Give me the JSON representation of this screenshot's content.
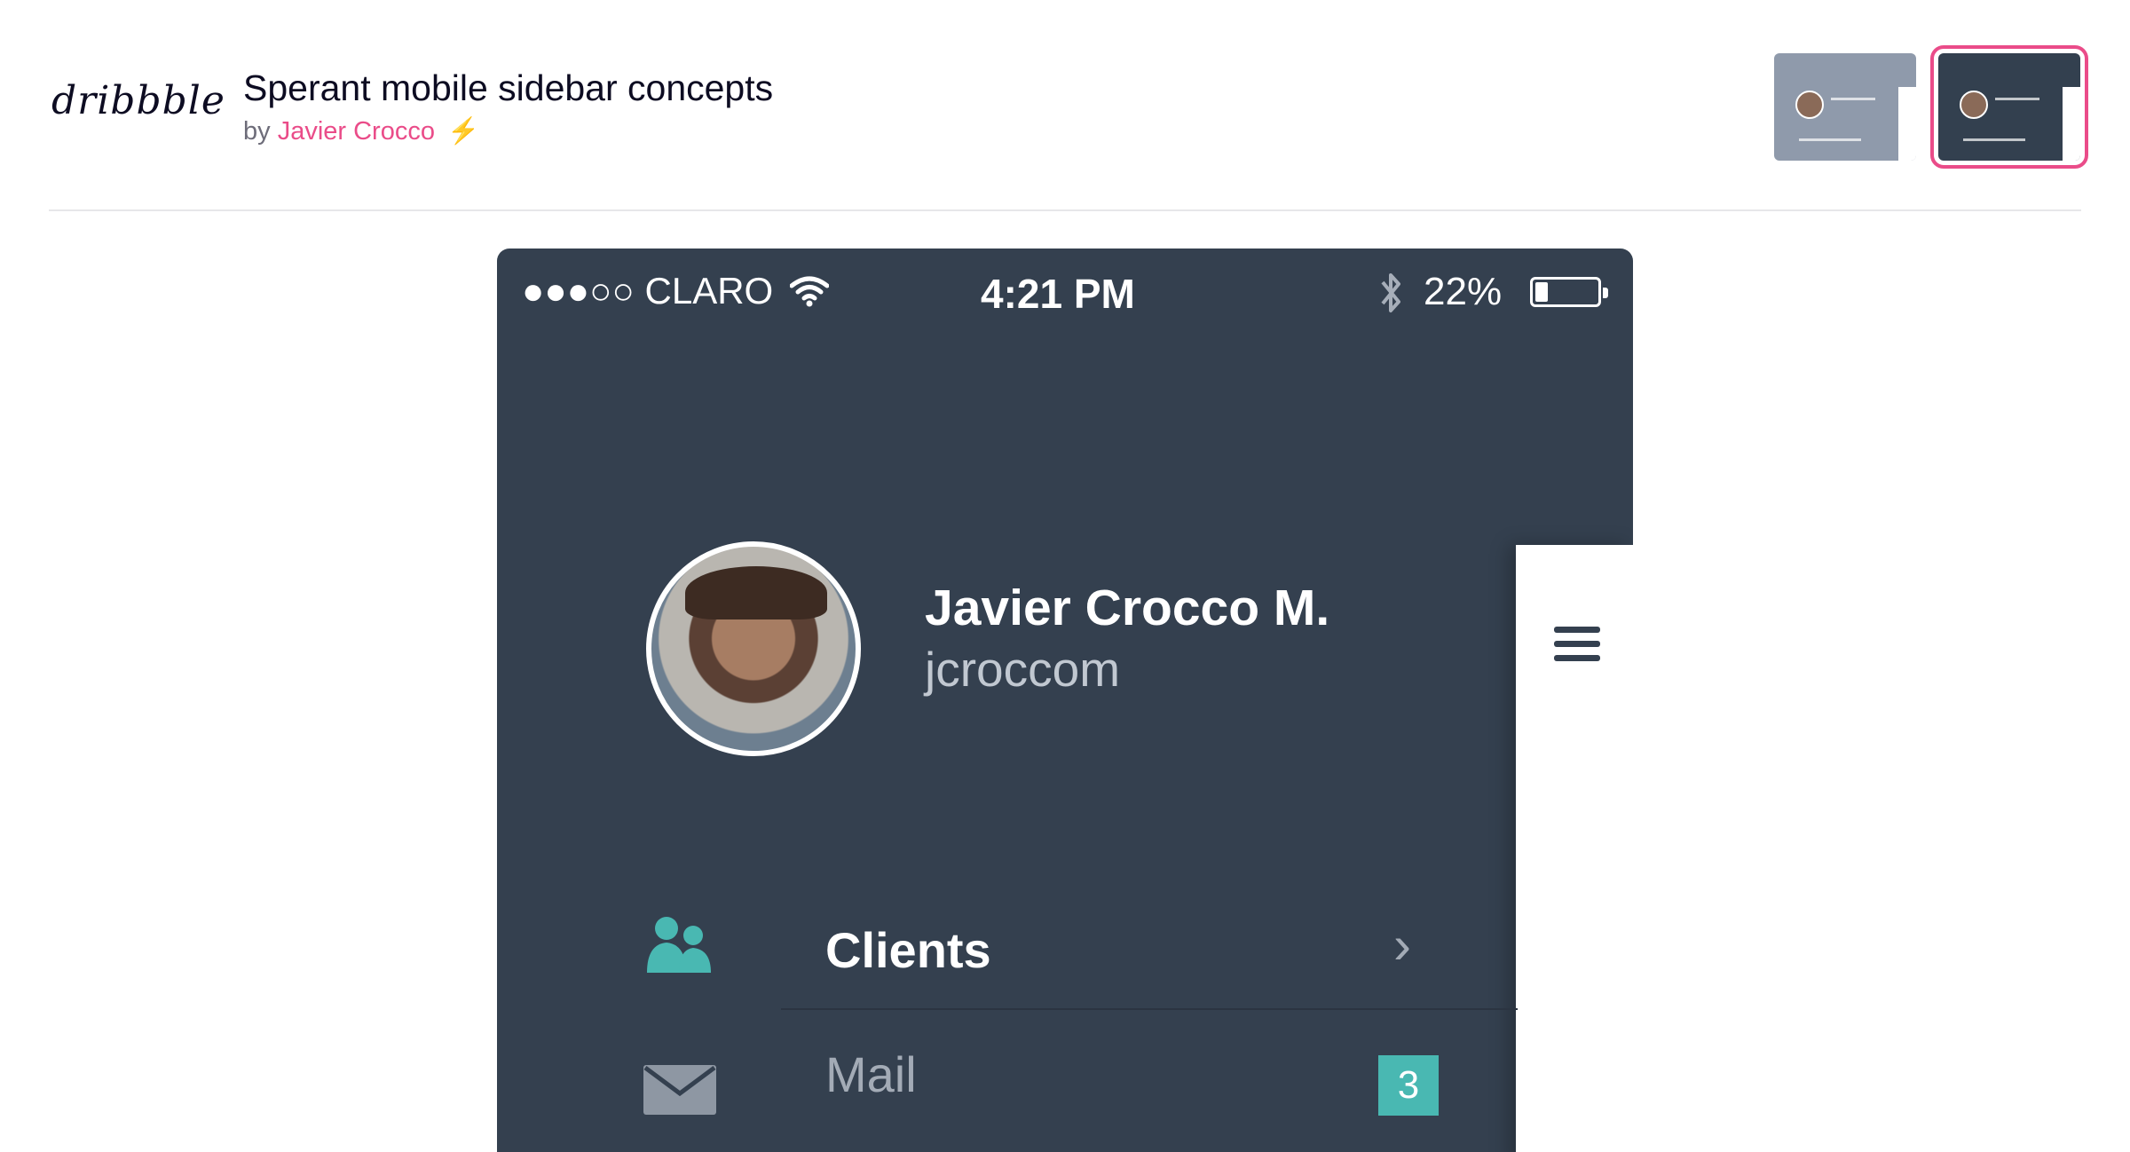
{
  "brand": {
    "logo_text": "dribbble"
  },
  "shot": {
    "title": "Sperant mobile sidebar concepts",
    "by_prefix": "by",
    "author": "Javier Crocco",
    "pro_icon": "lightning-bolt-icon"
  },
  "thumbnails": [
    {
      "name": "thumbnail-light",
      "selected": false
    },
    {
      "name": "thumbnail-dark",
      "selected": true
    }
  ],
  "phone": {
    "status_bar": {
      "signal": "●●●○○",
      "carrier": "CLARO",
      "wifi_icon": "wifi-icon",
      "time": "4:21 PM",
      "bluetooth_icon": "bluetooth-icon",
      "battery": "22%"
    },
    "profile": {
      "name": "Javier Crocco M.",
      "username": "jcroccom"
    },
    "menu": {
      "clients": {
        "label": "Clients",
        "icon": "clients-icon"
      },
      "mail": {
        "label": "Mail",
        "icon": "mail-icon",
        "badge": "3"
      }
    }
  },
  "colors": {
    "sidebar_bg": "#34404f",
    "accent_teal": "#49b8b2",
    "brand_pink": "#ea4c89"
  }
}
